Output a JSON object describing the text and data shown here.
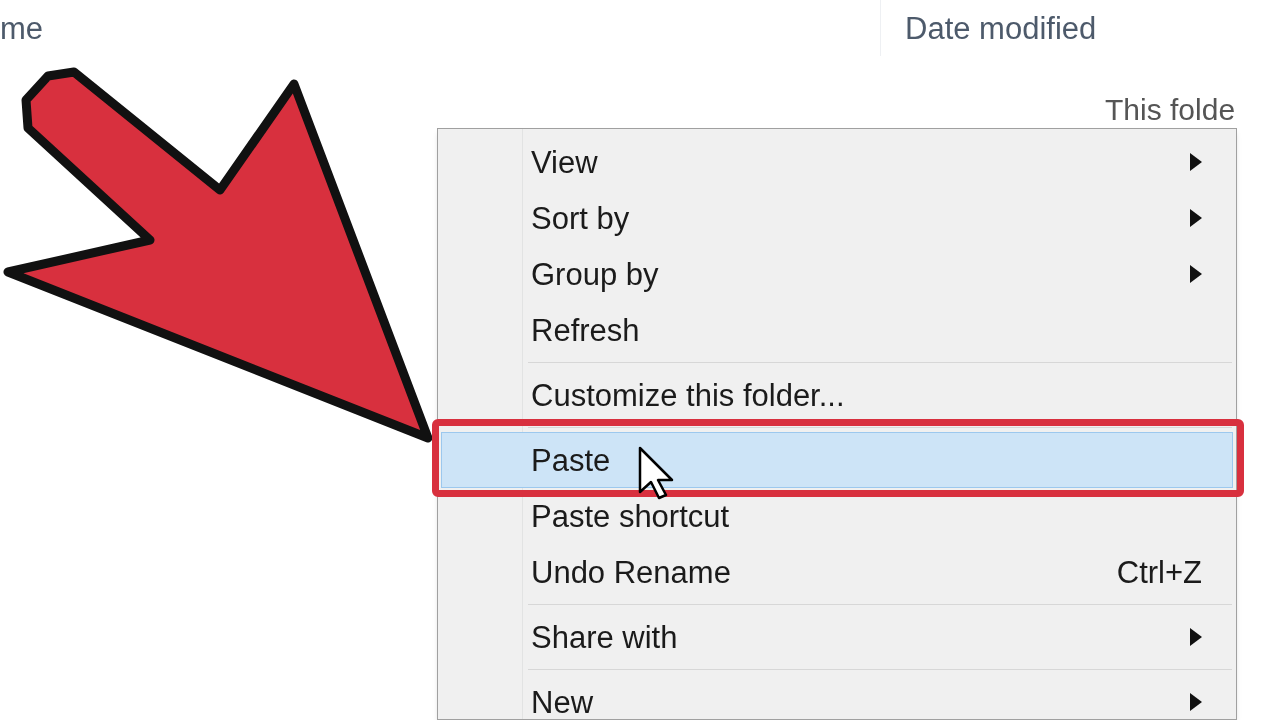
{
  "columns": [
    {
      "label": "me"
    },
    {
      "label": "Date modified"
    }
  ],
  "empty_message": "This folde",
  "context_menu": {
    "items": [
      {
        "kind": "item",
        "label": "View",
        "submenu": true,
        "selected": false
      },
      {
        "kind": "item",
        "label": "Sort by",
        "submenu": true,
        "selected": false
      },
      {
        "kind": "item",
        "label": "Group by",
        "submenu": true,
        "selected": false
      },
      {
        "kind": "item",
        "label": "Refresh",
        "submenu": false,
        "selected": false
      },
      {
        "kind": "separator"
      },
      {
        "kind": "item",
        "label": "Customize this folder...",
        "submenu": false,
        "selected": false
      },
      {
        "kind": "separator"
      },
      {
        "kind": "item",
        "label": "Paste",
        "submenu": false,
        "selected": true
      },
      {
        "kind": "item",
        "label": "Paste shortcut",
        "submenu": false,
        "selected": false
      },
      {
        "kind": "item",
        "label": "Undo Rename",
        "shortcut": "Ctrl+Z",
        "submenu": false,
        "selected": false
      },
      {
        "kind": "separator"
      },
      {
        "kind": "item",
        "label": "Share with",
        "submenu": true,
        "selected": false
      },
      {
        "kind": "separator"
      },
      {
        "kind": "item",
        "label": "New",
        "submenu": true,
        "selected": false
      }
    ]
  }
}
